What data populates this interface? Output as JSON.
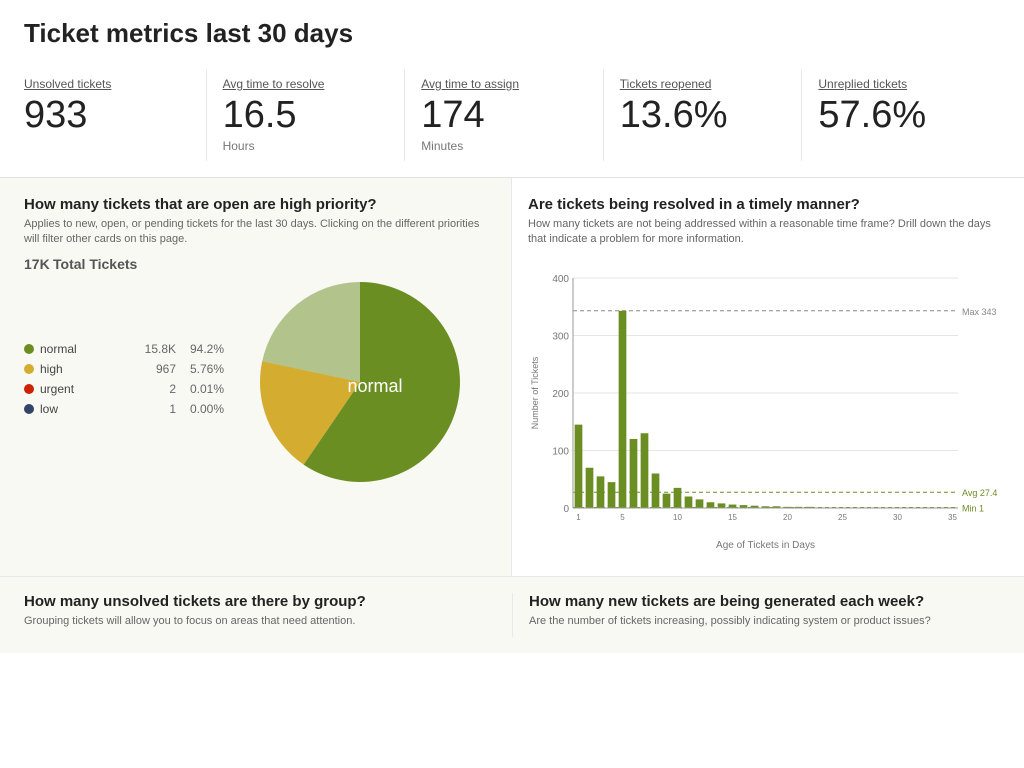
{
  "header": {
    "title": "Ticket metrics last 30 days"
  },
  "metrics": [
    {
      "id": "unsolved",
      "label": "Unsolved tickets",
      "value": "933",
      "unit": ""
    },
    {
      "id": "resolve",
      "label": "Avg time to resolve",
      "value": "16.5",
      "unit": "Hours"
    },
    {
      "id": "assign",
      "label": "Avg time to assign",
      "value": "174",
      "unit": "Minutes"
    },
    {
      "id": "reopened",
      "label": "Tickets reopened",
      "value": "13.6%",
      "unit": ""
    },
    {
      "id": "unreplied",
      "label": "Unreplied tickets",
      "value": "57.6%",
      "unit": ""
    }
  ],
  "priority_section": {
    "title": "How many tickets that are open are high priority?",
    "subtitle": "Applies to new, open, or pending tickets for the last 30 days. Clicking on the different priorities will filter other cards on this page.",
    "total_label": "17K",
    "total_suffix": "Total Tickets",
    "legend": [
      {
        "name": "normal",
        "color": "#6b8e23",
        "count": "15.8K",
        "pct": "94.2%"
      },
      {
        "name": "high",
        "color": "#d4ac30",
        "count": "967",
        "pct": "5.76%"
      },
      {
        "name": "urgent",
        "color": "#cc2200",
        "count": "2",
        "pct": "0.01%"
      },
      {
        "name": "low",
        "color": "#334466",
        "count": "1",
        "pct": "0.00%"
      }
    ]
  },
  "timely_section": {
    "title": "Are tickets being resolved in a timely manner?",
    "subtitle": "How many tickets are not being addressed within a reasonable time frame? Drill down the days that indicate a problem for more information.",
    "y_axis_label": "Number of Tickets",
    "x_axis_label": "Age of Tickets in Days",
    "max_label": "Max 343",
    "avg_label": "Avg 27.4",
    "min_label": "Min 1",
    "bars": [
      {
        "day": "1",
        "value": 145
      },
      {
        "day": "2",
        "value": 70
      },
      {
        "day": "3",
        "value": 55
      },
      {
        "day": "4",
        "value": 45
      },
      {
        "day": "5",
        "value": 343
      },
      {
        "day": "6",
        "value": 120
      },
      {
        "day": "7",
        "value": 130
      },
      {
        "day": "8",
        "value": 60
      },
      {
        "day": "9",
        "value": 25
      },
      {
        "day": "10",
        "value": 35
      },
      {
        "day": "11",
        "value": 20
      },
      {
        "day": "12",
        "value": 15
      },
      {
        "day": "13",
        "value": 10
      },
      {
        "day": "14",
        "value": 8
      },
      {
        "day": "15",
        "value": 6
      },
      {
        "day": "16",
        "value": 5
      },
      {
        "day": "17",
        "value": 4
      },
      {
        "day": "18",
        "value": 3
      },
      {
        "day": "19",
        "value": 3
      },
      {
        "day": "20",
        "value": 2
      },
      {
        "day": "21",
        "value": 2
      },
      {
        "day": "22",
        "value": 2
      },
      {
        "day": "23",
        "value": 1
      },
      {
        "day": "24",
        "value": 1
      },
      {
        "day": "25",
        "value": 1
      },
      {
        "day": "26",
        "value": 1
      },
      {
        "day": "27",
        "value": 1
      },
      {
        "day": "28",
        "value": 1
      },
      {
        "day": "29",
        "value": 1
      },
      {
        "day": "30",
        "value": 1
      },
      {
        "day": "31",
        "value": 1
      },
      {
        "day": "32",
        "value": 1
      },
      {
        "day": "33",
        "value": 1
      },
      {
        "day": "34",
        "value": 1
      },
      {
        "day": "35",
        "value": 1
      }
    ]
  },
  "bottom_left": {
    "title": "How many unsolved tickets are there by group?",
    "subtitle": "Grouping tickets will allow you to focus on areas that need attention."
  },
  "bottom_right": {
    "title": "How many new tickets are being generated each week?",
    "subtitle": "Are the number of tickets increasing, possibly indicating system or product issues?"
  }
}
